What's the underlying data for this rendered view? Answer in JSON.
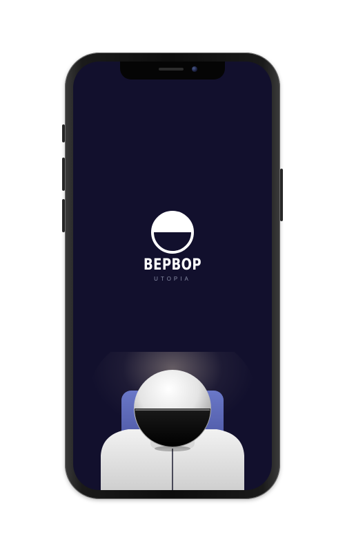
{
  "app": {
    "brand_name": "BEPBOP",
    "brand_subtitle": "UTOPIA"
  },
  "colors": {
    "screen_background": "#12102d",
    "logo": "#ffffff",
    "subtitle": "#8a8fa8"
  },
  "icons": {
    "logo": "half-filled-circle-logo",
    "illustration": "astronaut-helmet-illustration"
  }
}
